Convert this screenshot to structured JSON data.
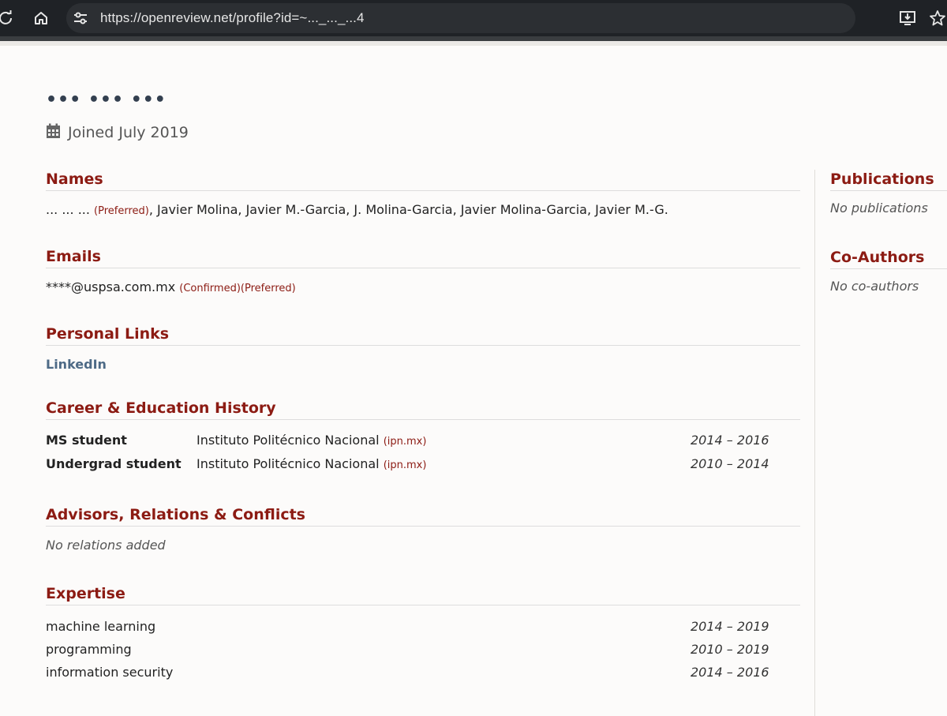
{
  "browser": {
    "url": "https://openreview.net/profile?id=~..._..._...4",
    "icons": [
      "reload-icon",
      "home-icon",
      "site-settings-icon",
      "install-app-icon",
      "bookmark-star-icon"
    ]
  },
  "profile": {
    "name": "••• ••• •••",
    "joined": "Joined July 2019"
  },
  "sections": {
    "names": {
      "title": "Names",
      "preferred_name": "... ... ...",
      "preferred_tag": "(Preferred)",
      "other_names": ", Javier Molina, Javier M.-Garcia, J. Molina-Garcia, Javier Molina-Garcia, Javier M.-G."
    },
    "emails": {
      "title": "Emails",
      "email": "****@uspsa.com.mx",
      "tags": "(Confirmed)(Preferred)"
    },
    "links": {
      "title": "Personal Links",
      "linkedin": "LinkedIn"
    },
    "history": {
      "title": "Career & Education History",
      "rows": [
        {
          "position": "MS student",
          "institution": "Instituto Politécnico Nacional",
          "domain": "(ipn.mx)",
          "years": "2014 – 2016"
        },
        {
          "position": "Undergrad student",
          "institution": "Instituto Politécnico Nacional",
          "domain": "(ipn.mx)",
          "years": "2010 – 2014"
        }
      ]
    },
    "relations": {
      "title": "Advisors, Relations & Conflicts",
      "empty": "No relations added"
    },
    "expertise": {
      "title": "Expertise",
      "rows": [
        {
          "topic": "machine learning",
          "years": "2014 – 2019"
        },
        {
          "topic": "programming",
          "years": "2010 – 2019"
        },
        {
          "topic": "information security",
          "years": "2014 – 2016"
        }
      ]
    }
  },
  "sidebar": {
    "publications": {
      "title": "Publications",
      "empty": "No publications"
    },
    "coauthors": {
      "title": "Co-Authors",
      "empty": "No co-authors"
    }
  },
  "colors": {
    "heading": "#8c1b13",
    "link": "#4d6a86",
    "chrome": "#1f2226"
  }
}
